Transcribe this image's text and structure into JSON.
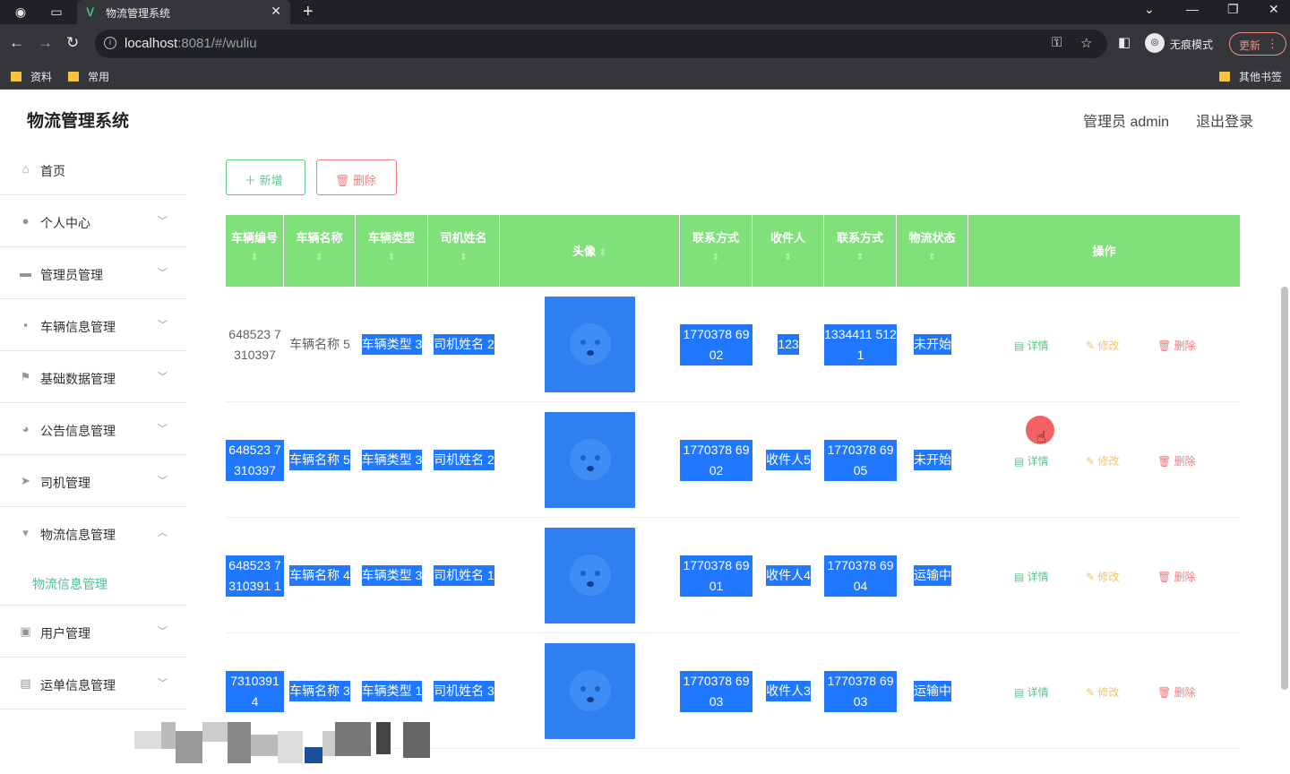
{
  "browser": {
    "tab_title": "物流管理系统",
    "url_host": "localhost",
    "url_rest": ":8081/#/wuliu",
    "profile_label": "无痕模式",
    "update_label": "更新",
    "bookmarks": [
      "资料",
      "常用"
    ],
    "other_bookmarks": "其他书签"
  },
  "header": {
    "brand": "物流管理系统",
    "admin": "管理员 admin",
    "logout": "退出登录"
  },
  "sidebar": {
    "items": [
      {
        "label": "首页",
        "icon": "home-icon",
        "arrow": ""
      },
      {
        "label": "个人中心",
        "icon": "user-icon",
        "arrow": "﹀"
      },
      {
        "label": "管理员管理",
        "icon": "briefcase-icon",
        "arrow": "﹀"
      },
      {
        "label": "车辆信息管理",
        "icon": "chat-icon",
        "arrow": "﹀"
      },
      {
        "label": "基础数据管理",
        "icon": "flag-icon",
        "arrow": "﹀"
      },
      {
        "label": "公告信息管理",
        "icon": "bulb-icon",
        "arrow": "﹀"
      },
      {
        "label": "司机管理",
        "icon": "send-icon",
        "arrow": "﹀"
      },
      {
        "label": "物流信息管理",
        "icon": "monitor-icon",
        "arrow": "︿"
      }
    ],
    "submenu": "物流信息管理",
    "items_after": [
      {
        "label": "用户管理",
        "icon": "chart-icon",
        "arrow": "﹀"
      },
      {
        "label": "运单信息管理",
        "icon": "card-icon",
        "arrow": "﹀"
      }
    ]
  },
  "toolbar": {
    "add_label": "新增",
    "delete_label": "删除"
  },
  "table": {
    "headers": [
      "车辆编号",
      "车辆名称",
      "车辆类型",
      "司机姓名",
      "头像",
      "联系方式",
      "收件人",
      "联系方式",
      "物流状态",
      "操作"
    ],
    "sort_mark": "⇕",
    "rows": [
      {
        "code": "648523 7310397",
        "name": "车辆名称 5",
        "type": "车辆类型 3",
        "driver": "司机姓名 2",
        "phone": "1770378 6902",
        "receiver": "123",
        "rphone": "1334411 5121",
        "status": "未开始",
        "sel_code": false,
        "sel_name": false
      },
      {
        "code": "648523 7310397",
        "name": "车辆名称 5",
        "type": "车辆类型 3",
        "driver": "司机姓名 2",
        "phone": "1770378 6902",
        "receiver": "收件人5",
        "rphone": "1770378 6905",
        "status": "未开始",
        "sel_code": true,
        "sel_name": true
      },
      {
        "code": "648523 7310391 1",
        "name": "车辆名称 4",
        "type": "车辆类型 3",
        "driver": "司机姓名 1",
        "phone": "1770378 6901",
        "receiver": "收件人4",
        "rphone": "1770378 6904",
        "status": "运输中",
        "sel_code": true,
        "sel_name": true
      },
      {
        "code": "7310391 4",
        "name": "车辆名称 3",
        "type": "车辆类型 1",
        "driver": "司机姓名 3",
        "phone": "1770378 6903",
        "receiver": "收件人3",
        "rphone": "1770378 6903",
        "status": "运输中",
        "sel_code": true,
        "sel_name": true
      }
    ],
    "actions": {
      "detail": "详情",
      "edit": "修改",
      "remove": "删除"
    }
  }
}
